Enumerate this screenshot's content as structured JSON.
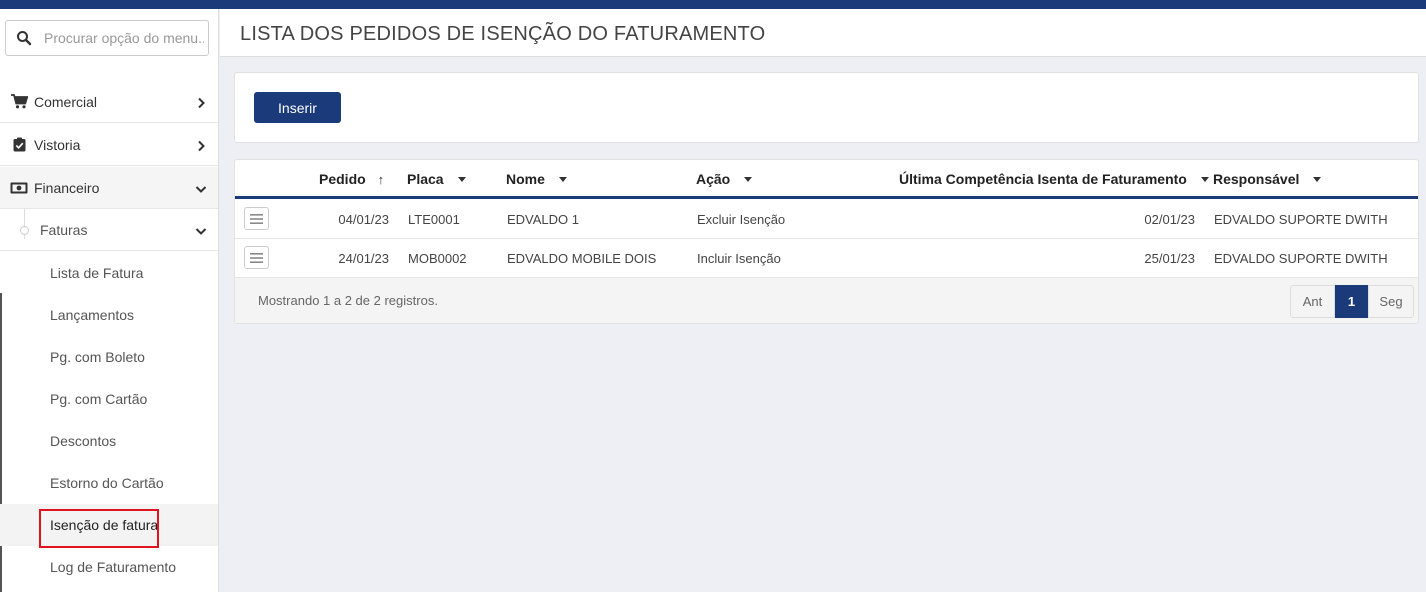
{
  "colors": {
    "accent": "#1a3a7a",
    "highlight": "#e0141e",
    "page_bg": "#eeeef5"
  },
  "sidebar": {
    "search_placeholder": "Procurar opção do menu...",
    "menus": [
      {
        "label": "Comercial",
        "icon": "cart-icon"
      },
      {
        "label": "Vistoria",
        "icon": "clipboard-check-icon"
      },
      {
        "label": "Financeiro",
        "icon": "money-icon"
      }
    ],
    "submenu": {
      "label": "Faturas"
    },
    "items": [
      {
        "label": "Lista de Fatura"
      },
      {
        "label": "Lançamentos"
      },
      {
        "label": "Pg. com Boleto"
      },
      {
        "label": "Pg. com Cartão"
      },
      {
        "label": "Descontos"
      },
      {
        "label": "Estorno do Cartão"
      },
      {
        "label": "Isenção de fatura",
        "active": true
      },
      {
        "label": "Log de Faturamento"
      }
    ]
  },
  "header": {
    "title": "LISTA DOS PEDIDOS DE ISENÇÃO DO FATURAMENTO"
  },
  "toolbar": {
    "insert_label": "Inserir"
  },
  "table": {
    "columns": [
      {
        "label": "Pedido",
        "sort": "asc"
      },
      {
        "label": "Placa"
      },
      {
        "label": "Nome"
      },
      {
        "label": "Ação"
      },
      {
        "label": "Última Competência Isenta de Faturamento"
      },
      {
        "label": "Responsável"
      }
    ],
    "rows": [
      {
        "pedido": "04/01/23",
        "placa": "LTE0001",
        "nome": "EDVALDO 1",
        "acao": "Excluir Isenção",
        "competencia": "02/01/23",
        "responsavel": "EDVALDO SUPORTE DWITH"
      },
      {
        "pedido": "24/01/23",
        "placa": "MOB0002",
        "nome": "EDVALDO MOBILE DOIS",
        "acao": "Incluir Isenção",
        "competencia": "25/01/23",
        "responsavel": "EDVALDO SUPORTE DWITH"
      }
    ],
    "footer_info": "Mostrando 1 a 2 de 2 registros.",
    "pager": {
      "prev": "Ant",
      "current": "1",
      "next": "Seg"
    }
  }
}
